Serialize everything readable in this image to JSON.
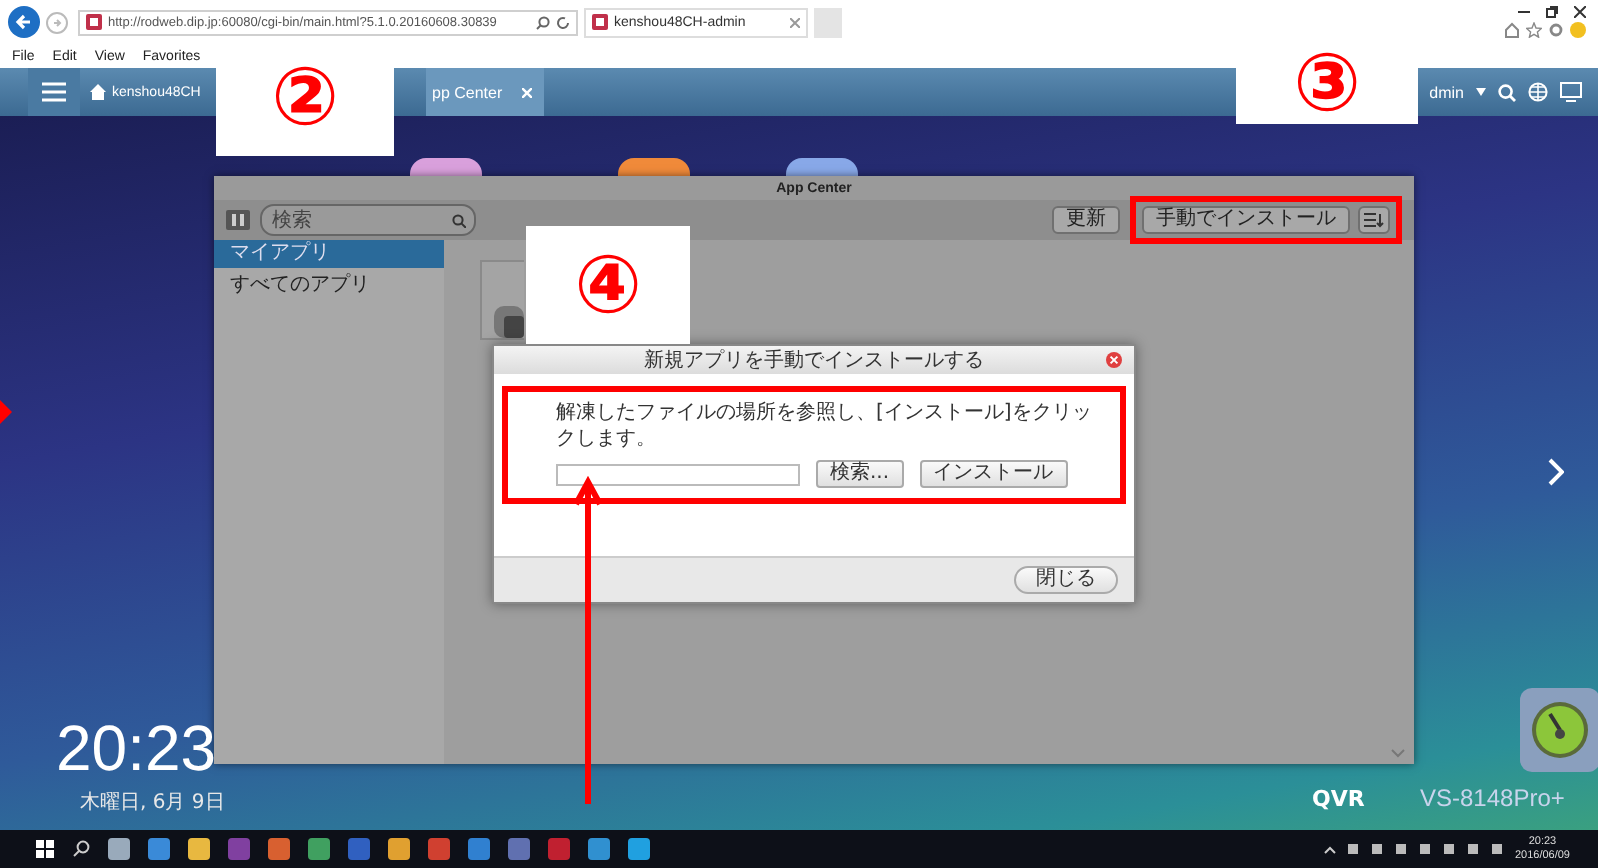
{
  "browser": {
    "url": "http://rodweb.dip.jp:60080/cgi-bin/main.html?5.1.0.20160608.30839",
    "tabs": [
      {
        "label": "kenshou48CH-admin",
        "selected": true
      }
    ],
    "menu": [
      "File",
      "Edit",
      "View",
      "Favorites"
    ]
  },
  "nas_bar": {
    "host": "kenshou48CH",
    "tabs": [
      {
        "label": "pp Center",
        "selected": true
      }
    ],
    "user": "dmin"
  },
  "app_center": {
    "title": "App Center",
    "search": {
      "placeholder": "検索"
    },
    "buttons": [
      "更新",
      "手動でインストール"
    ],
    "sidebar": [
      {
        "label": "マイアプリ",
        "selected": true
      },
      {
        "label": "すべてのアプリ",
        "selected": false
      }
    ]
  },
  "dialog": {
    "title": "新規アプリを手動でインストールする",
    "instruction": "解凍したファイルの場所を参照し、[インストール]をクリックします。",
    "buttons": [
      "検索...",
      "インストール"
    ],
    "close_button": "閉じる"
  },
  "desktop": {
    "time": "20:23",
    "date": "木曜日, 6月 9日",
    "brand": "QVR",
    "model": "VS-8148Pro+"
  },
  "taskbar": {
    "time": "20:23",
    "date": "2016/06/09"
  },
  "annotations": [
    {
      "label": "②"
    },
    {
      "label": "③"
    },
    {
      "label": "④"
    }
  ]
}
